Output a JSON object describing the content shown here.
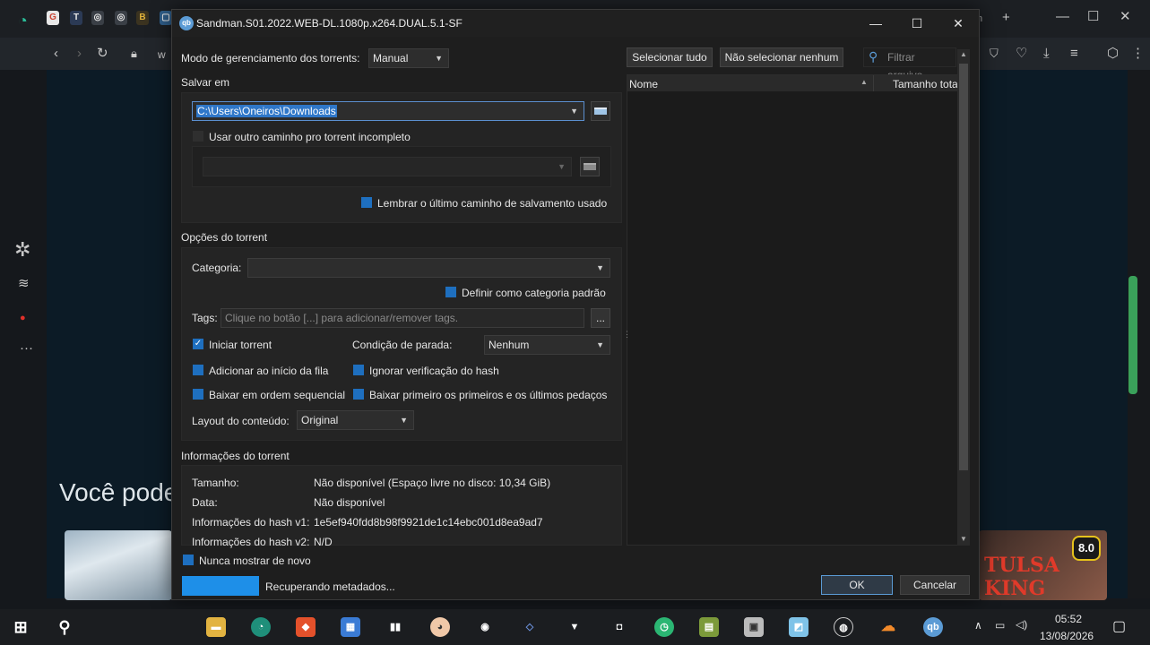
{
  "browser": {
    "heading": "Você pode",
    "thumb_title": "TULSA KING",
    "rating": "8.0",
    "address_fragment": "w"
  },
  "dialog": {
    "title": "Sandman.S01.2022.WEB-DL.1080p.x264.DUAL.5.1-SF",
    "management_mode_label": "Modo de gerenciamento dos torrents:",
    "management_mode_value": "Manual",
    "save_in_label": "Salvar em",
    "save_path": "C:\\Users\\Oneiros\\Downloads",
    "use_other_path_label": "Usar outro caminho pro torrent incompleto",
    "remember_path_label": "Lembrar o último caminho de salvamento usado",
    "torrent_options_label": "Opções do torrent",
    "category_label": "Categoria:",
    "category_value": "",
    "default_category_label": "Definir como categoria padrão",
    "tags_label": "Tags:",
    "tags_placeholder": "Clique no botão [...] para adicionar/remover tags.",
    "tags_button": "...",
    "start_torrent_label": "Iniciar torrent",
    "start_torrent_checked": true,
    "stop_condition_label": "Condição de parada:",
    "stop_condition_value": "Nenhum",
    "add_top_queue_label": "Adicionar ao início da fila",
    "skip_hash_label": "Ignorar verificação do hash",
    "sequential_label": "Baixar em ordem sequencial",
    "first_last_label": "Baixar primeiro os primeiros e os últimos pedaços",
    "content_layout_label": "Layout do conteúdo:",
    "content_layout_value": "Original",
    "info_label": "Informações do torrent",
    "info": [
      {
        "key": "Tamanho:",
        "value": "Não disponível (Espaço livre no disco: 10,34 GiB)"
      },
      {
        "key": "Data:",
        "value": "Não disponível"
      },
      {
        "key": "Informações do hash v1:",
        "value": "1e5ef940fdd8b98f9921de1c14ebc001d8ea9ad7"
      },
      {
        "key": "Informações do hash v2:",
        "value": "N/D"
      }
    ],
    "never_show_label": "Nunca mostrar de novo",
    "status_text": "Recuperando metadados...",
    "ok_button": "OK",
    "cancel_button": "Cancelar",
    "select_all_button": "Selecionar tudo",
    "select_none_button": "Não selecionar nenhum",
    "filter_placeholder": "Filtrar arquivo...",
    "col_name": "Nome",
    "col_size": "Tamanho total"
  },
  "taskbar": {
    "time": "05:52",
    "date": "13/08/2026"
  },
  "colors": {
    "accent": "#1e6fbf",
    "dialog_bg": "#1e1e1e",
    "progress": "#1e8fe8"
  }
}
